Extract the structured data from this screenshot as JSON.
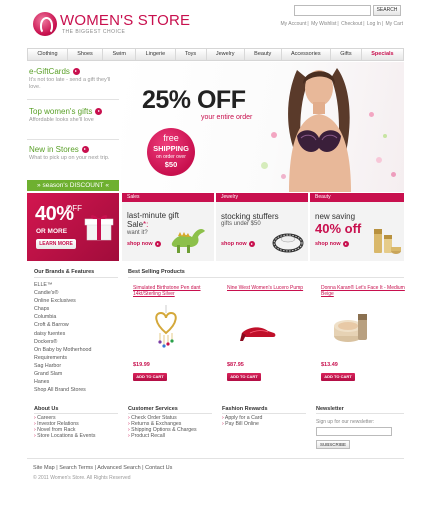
{
  "header": {
    "logo_title": "WOMEN'S STORE",
    "logo_subtitle": "THE BIGGEST CHOICE",
    "search_button": "SEARCH",
    "top_links": [
      "My Account",
      "My Wishlist",
      "Checkout",
      "Log In",
      "My Cart"
    ]
  },
  "nav": [
    "Clothing",
    "Shoes",
    "Swim",
    "Lingerie",
    "Toys",
    "Jewelry",
    "Beauty",
    "Accessories",
    "Gifts",
    "Specials"
  ],
  "sidebar": [
    {
      "title": "e-GiftCards",
      "desc": "It's not too late - send a gift they'll love."
    },
    {
      "title": "Top women's gifts",
      "desc": "Affordable looks she'll love"
    },
    {
      "title": "New in Stores",
      "desc": "What to pick up on your next trip."
    }
  ],
  "season_discount": "» season's DISCOUNT «",
  "hero": {
    "percent": "25% OFF",
    "subtitle": "your entire order",
    "badge_l1": "free",
    "badge_l2": "SHIPPING",
    "badge_l3": "on order over",
    "badge_l4": "$50"
  },
  "promo_left": {
    "percent": "40%",
    "off": "OFF",
    "more": "OR MORE",
    "button": "LEARN MORE"
  },
  "promo_cards": [
    {
      "category": "Sales",
      "title_a": "last-minute gift Sale",
      "title_b": "*:",
      "sub": "want it?",
      "shop": "shop now"
    },
    {
      "category": "Jewelry",
      "title_a": "stocking stuffers",
      "title_b": "",
      "sub": "gifts under $50",
      "shop": "shop now"
    },
    {
      "category": "Beauty",
      "title_a": "new saving",
      "title_b": "",
      "sub": "40% off",
      "shop": "shop now"
    }
  ],
  "brands": {
    "title": "Our Brands & Features",
    "items": [
      "ELLE™",
      "Candie's®",
      "Online Exclusives",
      "Chaps",
      "Columbia",
      "Croft & Barrow",
      "daisy fuentes",
      "Dockers®",
      "On Baby by Motherhood",
      "Requirements",
      "Sag Harbor",
      "Grand Slam",
      "Hanes",
      "Shop All Brand Stores"
    ]
  },
  "best_selling": {
    "title": "Best Selling Products",
    "add_to_cart": "ADD TO CART",
    "products": [
      {
        "name": "Simulated Birthstone Pen dant 14kt/Sterling Silver",
        "price": "$19.99"
      },
      {
        "name": "Nine West Women's Lucero Pump",
        "price": "$87.95"
      },
      {
        "name": "Donna Karan® Let's Face It - Medium Beige",
        "price": "$13.49"
      }
    ]
  },
  "footer": {
    "about": {
      "title": "About Us",
      "items": [
        "Careers",
        "Investor Relations",
        "Novel from Rack",
        "Store Locations & Events"
      ]
    },
    "service": {
      "title": "Customer Services",
      "items": [
        "Check Order Status",
        "Returns & Exchanges",
        "Shipping Options & Charges",
        "Product Recall"
      ]
    },
    "rewards": {
      "title": "Fashion Rewards",
      "items": [
        "Apply for a Card",
        "Pay Bill Online"
      ]
    },
    "newsletter": {
      "title": "Newsletter",
      "label": "Sign up for our newsletter:",
      "button": "SUBSCRIBE"
    }
  },
  "bottom_links": [
    "Site Map",
    "Search Terms",
    "Advanced Search",
    "Contact Us"
  ],
  "copyright": "© 2011 Women's Store. All Rights Reserved",
  "colors": {
    "brand": "#c8104e",
    "green": "#5aa028",
    "green_bar": "#6eb030"
  }
}
